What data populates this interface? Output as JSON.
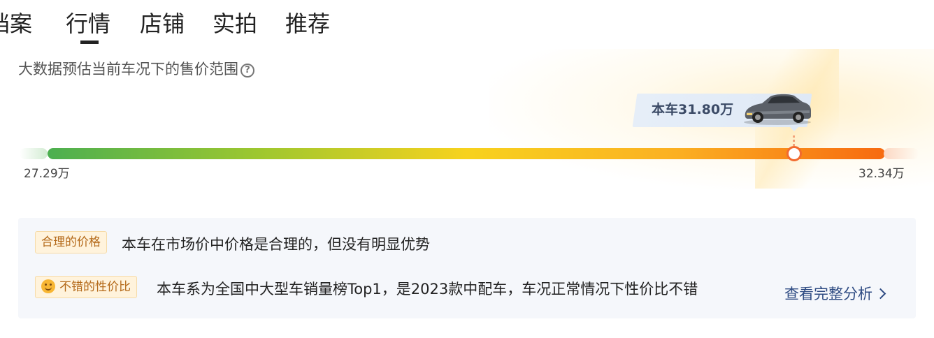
{
  "tabs": [
    {
      "label": "档案"
    },
    {
      "label": "行情"
    },
    {
      "label": "店铺"
    },
    {
      "label": "实拍"
    },
    {
      "label": "推荐"
    }
  ],
  "active_tab": "行情",
  "estimate": {
    "subtitle": "大数据预估当前车况下的售价范围",
    "help_icon": "question-circle-icon",
    "current_price_label": "本车31.80万",
    "min_label": "27.29万",
    "max_label": "32.34万",
    "current_price": 31.8,
    "min_price": 27.29,
    "max_price": 32.34
  },
  "analysis": {
    "items": [
      {
        "badge": "合理的价格",
        "text": "本车在市场价中价格是合理的，但没有明显优势"
      },
      {
        "badge": "不错的性价比",
        "badge_icon": "smile-icon",
        "text": "本车系为全国中大型车销量榜Top1，是2023款中配车，车况正常情况下性价比不错"
      }
    ],
    "more_link": "查看完整分析"
  },
  "colors": {
    "bar_start": "#4caf50",
    "bar_mid": "#f7d21e",
    "bar_end": "#f76a10",
    "marker": "#f26a2e",
    "link": "#2d4a82",
    "badge_text": "#b46a1a",
    "badge_bg": "#fff3dc"
  }
}
